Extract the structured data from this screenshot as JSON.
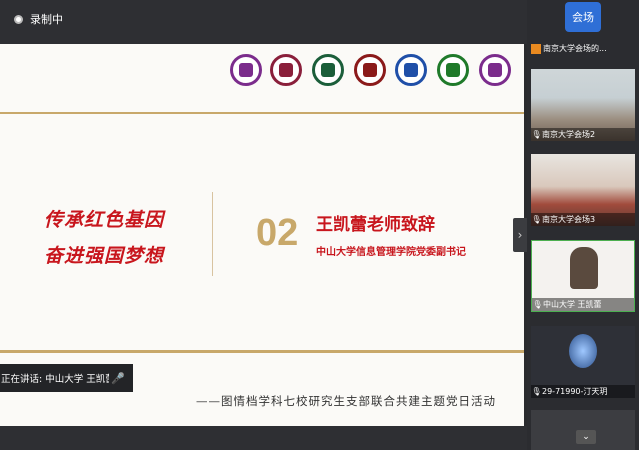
{
  "topbar": {
    "record_label": "录制中"
  },
  "slide": {
    "slogan_line1": "传承红色基因",
    "slogan_line2": "奋进强国梦想",
    "section_number": "02",
    "speaker_title": "王凯蕾老师致辞",
    "speaker_subtitle": "中山大学信息管理学院党委副书记",
    "caption": "——图情档学科七校研究生支部联合共建主题党日活动",
    "logo_colors": [
      "#7b2c8c",
      "#8a1f3b",
      "#1b5e3a",
      "#8b1a1a",
      "#1f4fa8",
      "#1f7a2a",
      "#7b2c8c"
    ]
  },
  "speaking_now": "正在讲话: 中山大学 王凯蕾;",
  "participants": {
    "host_avatar": "会场",
    "host_name": "南京大学会场的...",
    "tiles": [
      {
        "name": "南京大学会场2"
      },
      {
        "name": "南京大学会场3"
      },
      {
        "name": "中山大学 王凯蕾"
      },
      {
        "name": "29-71990-汀天玥"
      }
    ]
  },
  "icons": [
    "record-icon",
    "mic-icon",
    "chevron-right-icon",
    "chevron-down-icon"
  ]
}
